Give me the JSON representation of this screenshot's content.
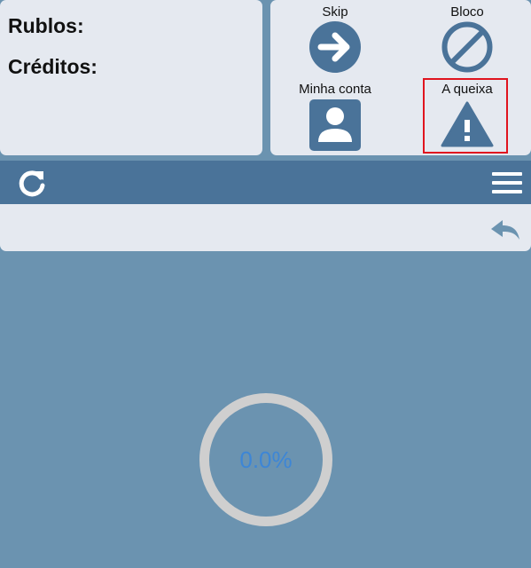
{
  "balance": {
    "rublos_label": "Rublos:",
    "creditos_label": "Créditos:"
  },
  "actions": {
    "skip": {
      "label": "Skip",
      "icon": "arrow-right-icon"
    },
    "bloco": {
      "label": "Bloco",
      "icon": "block-icon"
    },
    "minha_conta": {
      "label": "Minha conta",
      "icon": "user-icon"
    },
    "queixa": {
      "label": "A queixa",
      "icon": "warning-icon"
    }
  },
  "toolbar": {
    "refresh_icon": "refresh-icon",
    "menu_icon": "hamburger-menu-icon"
  },
  "subbar": {
    "back_icon": "reply-back-icon"
  },
  "progress": {
    "text": "0.0%",
    "value": 0.0
  },
  "colors": {
    "background": "#6b93b0",
    "panel": "#e5e9f0",
    "toolbar": "#4a7399",
    "icon": "#4a7399",
    "highlight": "#e0141e",
    "progress_text": "#3d86d6",
    "ring": "#cfcfcf"
  }
}
